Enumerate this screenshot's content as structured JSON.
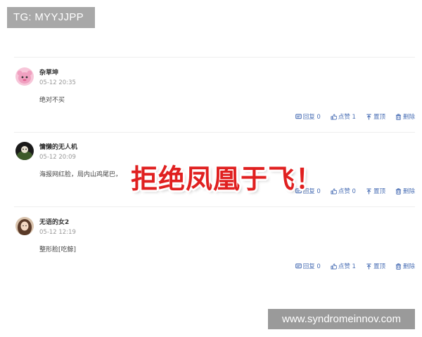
{
  "overlay_top_left": {
    "text": "TG: MYYJJPP"
  },
  "overlay_center": {
    "text": "拒绝凤凰于飞！"
  },
  "overlay_bottom_right": {
    "text": "www.syndromeinnov.com"
  },
  "comments": [
    {
      "username": "杂草坤",
      "time": "05-12 20:35",
      "content": "绝对不买",
      "avatar": "pink-cartoon-avatar",
      "actions": {
        "reply": "回复 0",
        "like": "点赞 1",
        "pin": "置顶",
        "delete": "删除"
      }
    },
    {
      "username": "慵懒的无人机",
      "time": "05-12 20:09",
      "content": "海报网红脸，局内山鸡尾巴，",
      "avatar": "dark-avatar",
      "actions": {
        "reply": "回复 0",
        "like": "点赞 0",
        "pin": "置顶",
        "delete": "删除"
      }
    },
    {
      "username": "无语的女2",
      "time": "05-12 12:19",
      "content": "整形脸[吃鲸]",
      "avatar": "portrait-avatar",
      "actions": {
        "reply": "回复 0",
        "like": "点赞 1",
        "pin": "置顶",
        "delete": "删除"
      }
    }
  ],
  "colors": {
    "action": "#4a6fb5",
    "overlay_red": "#e02020",
    "badge_gray": "#a8a8a8"
  }
}
